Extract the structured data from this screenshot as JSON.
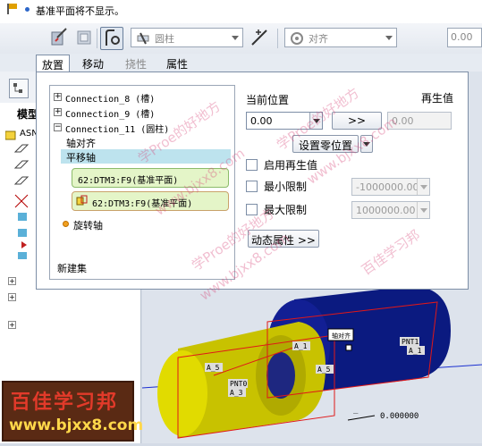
{
  "message_bar": {
    "text": "基准平面将不显示。"
  },
  "toolbar": {
    "connection_type": "圆柱",
    "constraint_type": "对齐",
    "offset_value": "0.00"
  },
  "tabs": [
    {
      "label": "放置",
      "active": true
    },
    {
      "label": "移动",
      "active": false
    },
    {
      "label": "挠性",
      "disabled": true
    },
    {
      "label": "属性",
      "active": false
    }
  ],
  "model_tree": {
    "title_partial": "模型",
    "root_partial": "ASN"
  },
  "placement_panel": {
    "connections": [
      {
        "label": "Connection_8 (槽)",
        "expander": "+"
      },
      {
        "label": "Connection_9 (槽)",
        "expander": "+"
      },
      {
        "label": "Connection_11 (圆柱)",
        "expander": "−"
      }
    ],
    "sub_items": {
      "axis_align": "轴对齐",
      "translation_axis": "平移轴",
      "references": [
        "62:DTM3:F9(基准平面)",
        "62:DTM3:F9(基准平面)"
      ],
      "rotation_axis": "旋转轴"
    },
    "new_set": "新建集",
    "current_position_label": "当前位置",
    "current_position_value": "0.00",
    "arrow_button": ">>",
    "regen_label": "再生值",
    "regen_value": "0.00",
    "set_zero_button": "设置零位置",
    "enable_regen_label": "启用再生值",
    "min_limit_label": "最小限制",
    "min_limit_value": "-1000000.00",
    "max_limit_label": "最大限制",
    "max_limit_value": "1000000.00",
    "dynamic_props_button": "动态属性 >>"
  },
  "viewport": {
    "labels": [
      "轴对齐",
      "A_1",
      "PNT1",
      "A_1",
      "A_5",
      "A_5",
      "PNT0",
      "A_3"
    ],
    "dimension": "0.000000"
  },
  "watermarks": [
    "学Proe的好地方",
    "www.bjxx8.com",
    "百佳学习邦"
  ],
  "logo": {
    "title": "百佳学习邦",
    "url": "www.bjxx8.com"
  }
}
